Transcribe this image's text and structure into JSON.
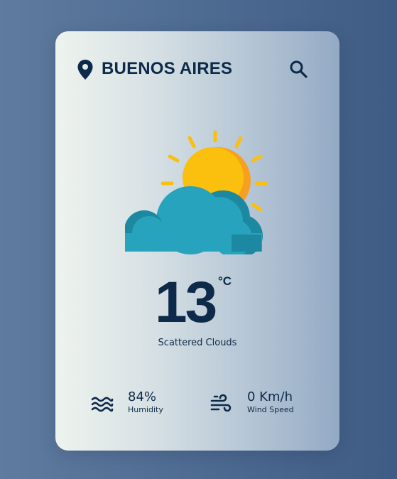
{
  "location": {
    "city": "BUENOS AIRES",
    "icon": "map-pin-icon"
  },
  "search": {
    "icon": "search-icon"
  },
  "weather": {
    "icon": "sun-behind-cloud-icon",
    "temperature": "13",
    "unit": "°C",
    "description": "Scattered Clouds"
  },
  "stats": {
    "humidity": {
      "value": "84%",
      "label": "Humidity",
      "icon": "water-waves-icon"
    },
    "wind": {
      "value": "0 Km/h",
      "label": "Wind Speed",
      "icon": "wind-icon"
    }
  },
  "colors": {
    "text": "#0e2a4a",
    "sun": "#fbbf0e",
    "sun_shade": "#f7a01f",
    "cloud": "#28a3bd",
    "cloud_shade": "#1d88a1"
  }
}
